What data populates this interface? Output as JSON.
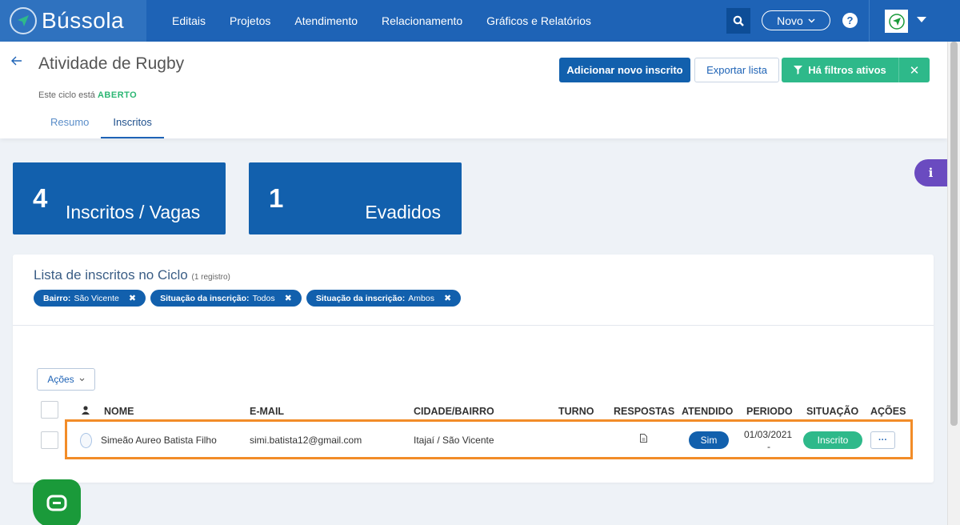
{
  "brand": {
    "name": "Bússola"
  },
  "nav": {
    "items": [
      "Editais",
      "Projetos",
      "Atendimento",
      "Relacionamento",
      "Gráficos e Relatórios"
    ],
    "novo_label": "Novo",
    "help_label": "?"
  },
  "header": {
    "back_icon": "arrow-left-icon",
    "title": "Atividade de Rugby",
    "status_prefix": "Este ciclo está",
    "status_value": "ABERTO",
    "tabs": [
      "Resumo",
      "Inscritos"
    ],
    "active_tab": "Inscritos",
    "add_button": "Adicionar novo inscrito",
    "export_button": "Exportar lista",
    "filters_button": "Há filtros ativos"
  },
  "info_label": "i",
  "stats": [
    {
      "value": "4",
      "label": "Inscritos / Vagas"
    },
    {
      "value": "1",
      "label": "Evadidos"
    }
  ],
  "list": {
    "title": "Lista de inscritos no Ciclo",
    "count": "(1 registro)",
    "filters": [
      {
        "key": "Bairro:",
        "value": "São Vicente"
      },
      {
        "key": "Situação da inscrição:",
        "value": "Todos"
      },
      {
        "key": "Situação da inscrição:",
        "value": "Ambos"
      }
    ],
    "actions_label": "Ações",
    "columns": [
      "NOME",
      "E-MAIL",
      "CIDADE/BAIRRO",
      "TURNO",
      "RESPOSTAS",
      "ATENDIDO",
      "PERIODO",
      "SITUAÇÃO",
      "AÇÕES"
    ],
    "rows": [
      {
        "name": "Simeão Aureo Batista Filho",
        "email": "simi.batista12@gmail.com",
        "city": "Itajaí / São Vicente",
        "turno": "",
        "atendido": "Sim",
        "periodo": "01/03/2021",
        "periodo_end": "-",
        "situacao": "Inscrito",
        "more": "···"
      }
    ]
  },
  "colors": {
    "topbar": "#1e63b6",
    "primary": "#1260ad",
    "success": "#2eb98a",
    "highlight": "#f28c28",
    "info": "#6a4bc0",
    "chat": "#1a9a3a"
  }
}
